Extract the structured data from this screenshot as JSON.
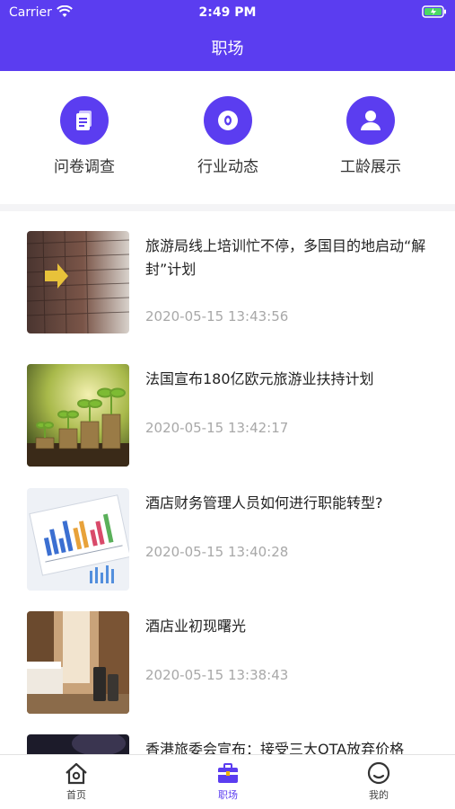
{
  "status_bar": {
    "carrier": "Carrier",
    "time": "2:49 PM",
    "wifi_icon": "wifi-icon",
    "battery_icon": "battery-charging-icon"
  },
  "nav": {
    "title": "职场"
  },
  "quick_actions": [
    {
      "label": "问卷调查",
      "icon": "document-icon"
    },
    {
      "label": "行业动态",
      "icon": "eye-icon"
    },
    {
      "label": "工龄展示",
      "icon": "user-icon"
    }
  ],
  "news": [
    {
      "title": "旅游局线上培训忙不停，多国目的地启动“解封”计划",
      "date": "2020-05-15 13:43:56",
      "thumb": "brick-wall-arrow-image"
    },
    {
      "title": "法国宣布180亿欧元旅游业扶持计划",
      "date": "2020-05-15 13:42:17",
      "thumb": "coins-plants-image"
    },
    {
      "title": "酒店财务管理人员如何进行职能转型?",
      "date": "2020-05-15 13:40:28",
      "thumb": "financial-charts-image"
    },
    {
      "title": "酒店业初现曙光",
      "date": "2020-05-15 13:38:43",
      "thumb": "hotel-room-image"
    },
    {
      "title": "香港旅委会宣布：接受三大OTA放弃价格",
      "date": "",
      "thumb": "dark-image"
    }
  ],
  "tabs": [
    {
      "label": "首页",
      "icon": "home-icon",
      "active": false
    },
    {
      "label": "职场",
      "icon": "briefcase-icon",
      "active": true
    },
    {
      "label": "我的",
      "icon": "smile-face-icon",
      "active": false
    }
  ],
  "colors": {
    "brand": "#5b3df0",
    "text": "#222222",
    "muted": "#a8a8a8"
  }
}
